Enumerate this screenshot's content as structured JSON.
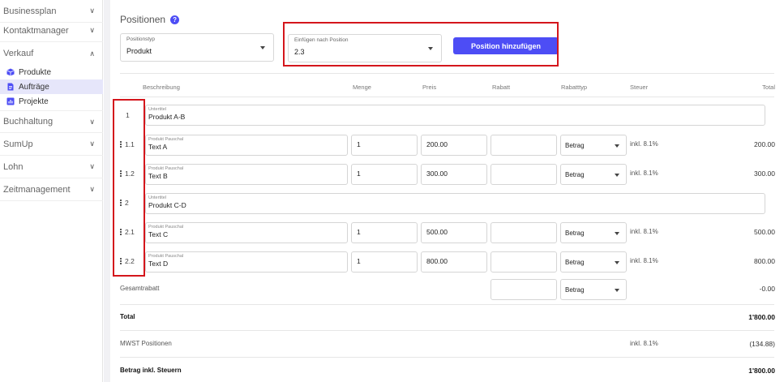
{
  "sidebar": {
    "items": [
      {
        "label": "Businessplan",
        "chev": "∨"
      },
      {
        "label": "Kontaktmanager",
        "chev": "∨"
      },
      {
        "label": "Verkauf",
        "chev": "∧"
      },
      {
        "label": "Buchhaltung",
        "chev": "∨"
      },
      {
        "label": "SumUp",
        "chev": "∨"
      },
      {
        "label": "Lohn",
        "chev": "∨"
      },
      {
        "label": "Zeitmanagement",
        "chev": "∨"
      }
    ],
    "sub_items": [
      {
        "label": "Produkte",
        "icon": "cube-icon"
      },
      {
        "label": "Aufträge",
        "icon": "document-icon"
      },
      {
        "label": "Projekte",
        "icon": "bar-chart-icon"
      }
    ]
  },
  "main": {
    "title": "Positionen",
    "help_icon": "?",
    "positionstyp": {
      "label": "Positionstyp",
      "value": "Produkt"
    },
    "einfuegen": {
      "label": "Einfügen nach Position",
      "value": "2.3"
    },
    "add_button": "Position hinzufügen",
    "headers": {
      "beschreibung": "Beschreibung",
      "menge": "Menge",
      "preis": "Preis",
      "rabatt": "Rabatt",
      "rabatttyp": "Rabatttyp",
      "steuer": "Steuer",
      "total": "Total"
    },
    "rows": [
      {
        "num": "1",
        "type": "Untertitel",
        "desc": "Produkt A-B"
      },
      {
        "num": "1.1",
        "type": "Produkt Pauschal",
        "desc": "Text A",
        "menge": "1",
        "preis": "200.00",
        "rabatt": "",
        "rabatttyp": "Betrag",
        "steuer": "inkl. 8.1%",
        "total": "200.00"
      },
      {
        "num": "1.2",
        "type": "Produkt Pauschal",
        "desc": "Text B",
        "menge": "1",
        "preis": "300.00",
        "rabatt": "",
        "rabatttyp": "Betrag",
        "steuer": "inkl. 8.1%",
        "total": "300.00"
      },
      {
        "num": "2",
        "type": "Untertitel",
        "desc": "Produkt C-D"
      },
      {
        "num": "2.1",
        "type": "Produkt Pauschal",
        "desc": "Text C",
        "menge": "1",
        "preis": "500.00",
        "rabatt": "",
        "rabatttyp": "Betrag",
        "steuer": "inkl. 8.1%",
        "total": "500.00"
      },
      {
        "num": "2.2",
        "type": "Produkt Pauschal",
        "desc": "Text D",
        "menge": "1",
        "preis": "800.00",
        "rabatt": "",
        "rabatttyp": "Betrag",
        "steuer": "inkl. 8.1%",
        "total": "800.00"
      }
    ],
    "gesamtrabatt": {
      "label": "Gesamtrabatt",
      "value": "",
      "typ": "Betrag",
      "total": "-0.00"
    },
    "summary": {
      "total_label": "Total",
      "total_value": "1'800.00",
      "mwst_label": "MWST Positionen",
      "mwst_rate": "inkl. 8.1%",
      "mwst_value": "(134.88)",
      "brutto_label": "Betrag inkl. Steuern",
      "brutto_value": "1'800.00"
    }
  },
  "colors": {
    "accent": "#4d4df5",
    "highlight": "#d4161c",
    "active_bg": "#e6e6fa"
  }
}
